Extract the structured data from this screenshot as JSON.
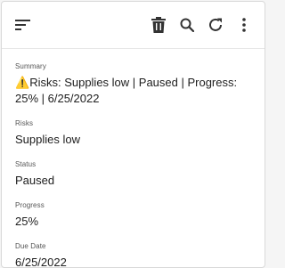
{
  "toolbar": {
    "menu_icon": "menu-icon",
    "delete_icon": "trash-icon",
    "search_icon": "search-icon",
    "refresh_icon": "refresh-icon",
    "more_icon": "more-vert-icon"
  },
  "summary": {
    "label": "Summary",
    "warning_glyph": "⚠️",
    "value": "Risks: Supplies low | Paused | Progress: 25% | 6/25/2022"
  },
  "risks": {
    "label": "Risks",
    "value": "Supplies low"
  },
  "status": {
    "label": "Status",
    "value": "Paused"
  },
  "progress": {
    "label": "Progress",
    "value": "25%"
  },
  "due_date": {
    "label": "Due Date",
    "value": "6/25/2022"
  }
}
